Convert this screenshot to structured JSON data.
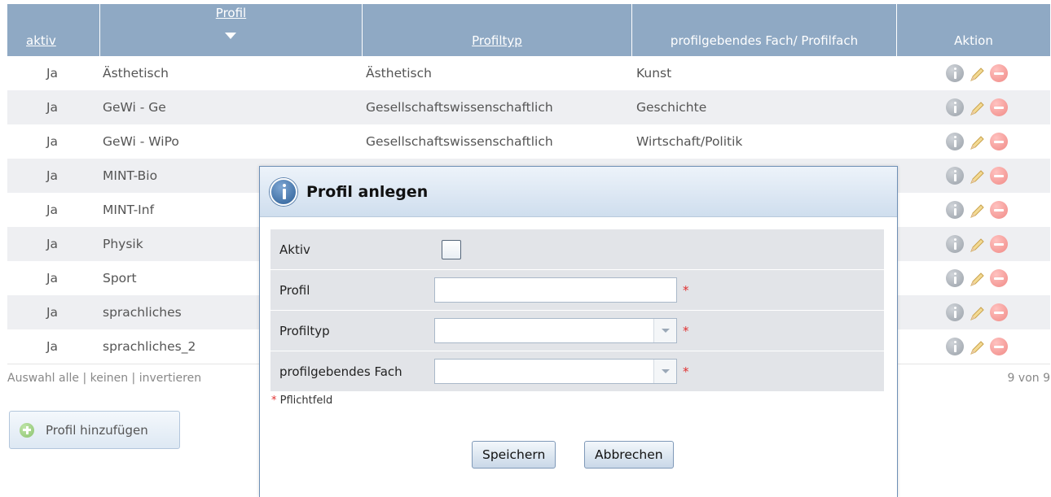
{
  "table": {
    "headers": {
      "aktiv": "aktiv",
      "profil": "Profil",
      "profiltyp": "Profiltyp",
      "fach": "profilgebendes Fach/ Profilfach",
      "aktion": "Aktion"
    },
    "rows": [
      {
        "aktiv": "Ja",
        "profil": "Ästhetisch",
        "profiltyp": "Ästhetisch",
        "fach": "Kunst"
      },
      {
        "aktiv": "Ja",
        "profil": "GeWi - Ge",
        "profiltyp": "Gesellschaftswissenschaftlich",
        "fach": "Geschichte"
      },
      {
        "aktiv": "Ja",
        "profil": "GeWi - WiPo",
        "profiltyp": "Gesellschaftswissenschaftlich",
        "fach": "Wirtschaft/Politik"
      },
      {
        "aktiv": "Ja",
        "profil": "MINT-Bio",
        "profiltyp": "",
        "fach": ""
      },
      {
        "aktiv": "Ja",
        "profil": "MINT-Inf",
        "profiltyp": "",
        "fach": ""
      },
      {
        "aktiv": "Ja",
        "profil": "Physik",
        "profiltyp": "",
        "fach": ""
      },
      {
        "aktiv": "Ja",
        "profil": "Sport",
        "profiltyp": "",
        "fach": ""
      },
      {
        "aktiv": "Ja",
        "profil": "sprachliches",
        "profiltyp": "",
        "fach": ""
      },
      {
        "aktiv": "Ja",
        "profil": "sprachliches_2",
        "profiltyp": "",
        "fach": ""
      }
    ],
    "footer": {
      "auswahl": "Auswahl",
      "alle": "alle",
      "sep": "|",
      "keinen": "keinen",
      "invertieren": "invertieren",
      "count": "9 von 9"
    },
    "row_icons": [
      "info-icon",
      "edit-pencil-icon",
      "delete-icon"
    ]
  },
  "add_button": {
    "label": "Profil hinzufügen",
    "icon": "plus-icon"
  },
  "dialog": {
    "title": "Profil anlegen",
    "icon": "info-icon",
    "fields": {
      "aktiv_label": "Aktiv",
      "aktiv_checked": false,
      "profil_label": "Profil",
      "profil_value": "",
      "profiltyp_label": "Profiltyp",
      "profiltyp_value": "",
      "fach_label": "profilgebendes Fach",
      "fach_value": "",
      "required_mark": "*"
    },
    "required_note": "Pflichtfeld",
    "save_label": "Speichern",
    "cancel_label": "Abbrechen"
  },
  "colors": {
    "header_bg": "#8fa9c4",
    "row_alt": "#eeeff2",
    "dialog_border": "#6e8fb5",
    "required": "#e03030"
  }
}
